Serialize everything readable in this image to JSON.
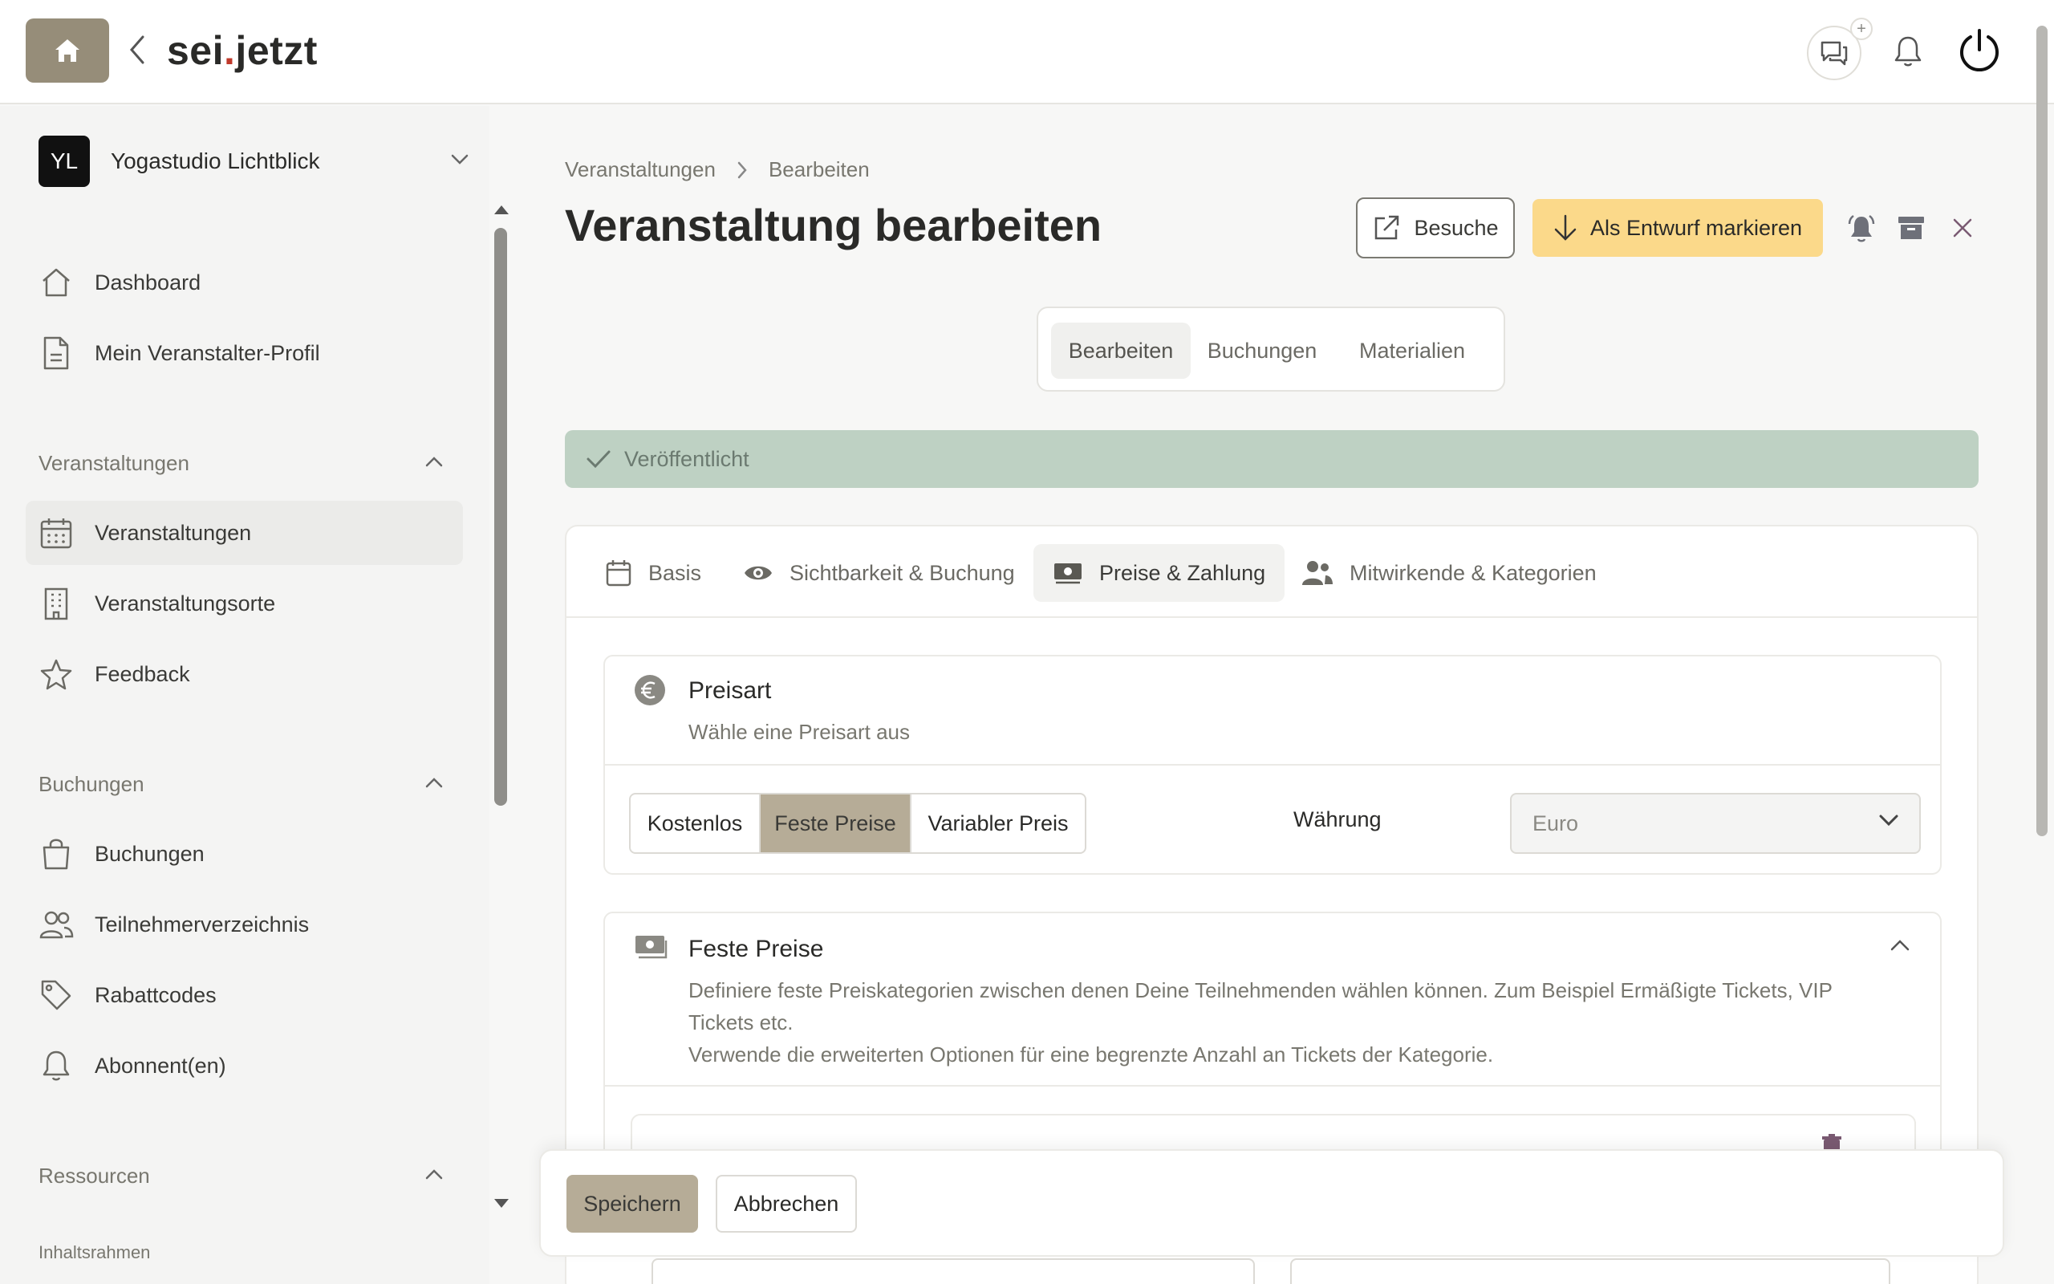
{
  "app": {
    "brand_prefix": "sei",
    "brand_dot": ".",
    "brand_suffix": "jetzt",
    "chat_plus": "+"
  },
  "icons": {
    "home": "home-icon",
    "back": "chevron-left-icon",
    "chat": "chat-icon",
    "bell": "bell-icon",
    "power": "power-icon"
  },
  "colors": {
    "accent": "#968d79",
    "draft": "#fbd98a",
    "published": "#bed1c3",
    "active_segment": "#b6ac97"
  },
  "sidebar": {
    "org": {
      "initials": "YL",
      "name": "Yogastudio Lichtblick"
    },
    "top_items": [
      {
        "label": "Dashboard",
        "icon": "home-icon"
      },
      {
        "label": "Mein Veranstalter-Profil",
        "icon": "document-icon"
      }
    ],
    "sections": [
      {
        "title": "Veranstaltungen",
        "items": [
          {
            "label": "Veranstaltungen",
            "icon": "calendar-icon",
            "active": true
          },
          {
            "label": "Veranstaltungsorte",
            "icon": "building-icon"
          },
          {
            "label": "Feedback",
            "icon": "star-icon"
          }
        ]
      },
      {
        "title": "Buchungen",
        "items": [
          {
            "label": "Buchungen",
            "icon": "bag-icon"
          },
          {
            "label": "Teilnehmerverzeichnis",
            "icon": "users-icon"
          },
          {
            "label": "Rabattcodes",
            "icon": "tag-icon"
          },
          {
            "label": "Abonnent(en)",
            "icon": "bell-icon"
          }
        ]
      },
      {
        "title": "Ressourcen",
        "items": []
      }
    ],
    "subsection": "Inhaltsrahmen"
  },
  "main": {
    "breadcrumb": [
      "Veranstaltungen",
      "Bearbeiten"
    ],
    "title": "Veranstaltung bearbeiten",
    "visits_label": "Besuche",
    "draft_label": "Als Entwurf markieren",
    "view_tabs": [
      {
        "label": "Bearbeiten",
        "active": true
      },
      {
        "label": "Buchungen"
      },
      {
        "label": "Materialien"
      }
    ],
    "status": "Veröffentlicht",
    "section_tabs": [
      {
        "label": "Basis",
        "icon": "calendar-icon"
      },
      {
        "label": "Sichtbarkeit & Buchung",
        "icon": "eye-icon"
      },
      {
        "label": "Preise & Zahlung",
        "icon": "money-icon",
        "active": true
      },
      {
        "label": "Mitwirkende & Kategorien",
        "icon": "users-icon"
      }
    ],
    "price_type": {
      "title": "Preisart",
      "subtitle": "Wähle eine Preisart aus",
      "options": [
        "Kostenlos",
        "Feste Preise",
        "Variabler Preis"
      ],
      "selected": "Feste Preise",
      "currency_label": "Währung",
      "currency_value": "Euro"
    },
    "fixed_prices": {
      "title": "Feste Preise",
      "description_1": "Definiere feste Preiskategorien zwischen denen Deine Teilnehmenden wählen können. Zum Beispiel Ermäßigte Tickets, VIP Tickets etc.",
      "description_2": "Verwende die erweiterten Optionen für eine begrenzte Anzahl an Tickets der Kategorie."
    },
    "footer": {
      "save": "Speichern",
      "cancel": "Abbrechen"
    }
  }
}
